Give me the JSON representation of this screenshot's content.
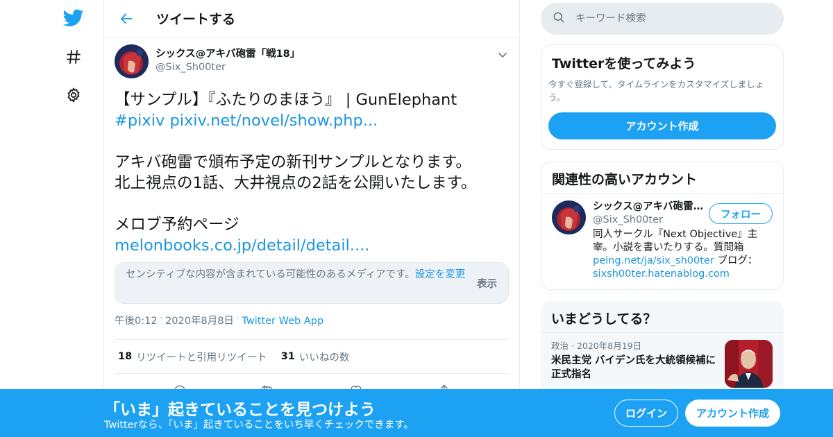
{
  "colors": {
    "accent": "#1da1f2",
    "link": "#1b95e0",
    "text": "#14171a",
    "muted": "#657786",
    "border": "#e6ecf0"
  },
  "nav": {
    "icons": [
      "twitter-bird-icon",
      "hashtag-icon",
      "gear-icon"
    ]
  },
  "header": {
    "title": "ツイートする",
    "back_icon": "arrow-left-icon"
  },
  "tweet": {
    "author_name": "シックス@アキバ砲雷「戦18」",
    "author_handle": "@Six_Sh00ter",
    "text_line1": "【サンプル】『ふたりのまほう』 | GunElephant",
    "hashtag": "#pixiv",
    "url1": "pixiv.net/novel/show.php...",
    "paragraph2": "アキバ砲雷で頒布予定の新刊サンプルとなります。\n北上視点の1話、大井視点の2話を公開いたします。",
    "paragraph3": "メロブ予約ページ",
    "url2": "melonbooks.co.jp/detail/detail....",
    "sensitive_text": "センシティブな内容が含まれている可能性のあるメディアです。",
    "sensitive_link": "設定を変更",
    "show_label": "表示",
    "time": "午後0:12",
    "date": "2020年8月8日",
    "app": "Twitter Web App",
    "retweet_count": "18",
    "retweet_label": "リツイートと引用リツイート",
    "like_count": "31",
    "like_label": "いいねの数"
  },
  "sidebar": {
    "search_placeholder": "キーワード検索",
    "signup_card": {
      "title": "Twitterを使ってみよう",
      "description": "今すぐ登録して、タイムラインをカスタマイズしましょう。",
      "button": "アカウント作成"
    },
    "related_card": {
      "title": "関連性の高いアカウント",
      "name": "シックス@アキバ砲雷「戦18」",
      "handle": "@Six_Sh00ter",
      "follow": "フォロー",
      "bio_text": "同人サークル『Next Objective』主宰。小説を書いたりする。質問箱",
      "bio_link1": "peing.net/ja/six_sh00ter",
      "bio_mid": " ブログ：",
      "bio_link2": "sixsh00ter.hatenablog.com"
    },
    "trends_card": {
      "title": "いまどうしてる？",
      "category": "政治",
      "date": "2020年8月19日",
      "headline": "米民主党 バイデン氏を大統領候補に正式指名"
    }
  },
  "banner": {
    "title": "「いま」起きていることを見つけよう",
    "subtitle": "Twitterなら、「いま」起きていることをいち早くチェックできます。",
    "login": "ログイン",
    "signup": "アカウント作成"
  }
}
